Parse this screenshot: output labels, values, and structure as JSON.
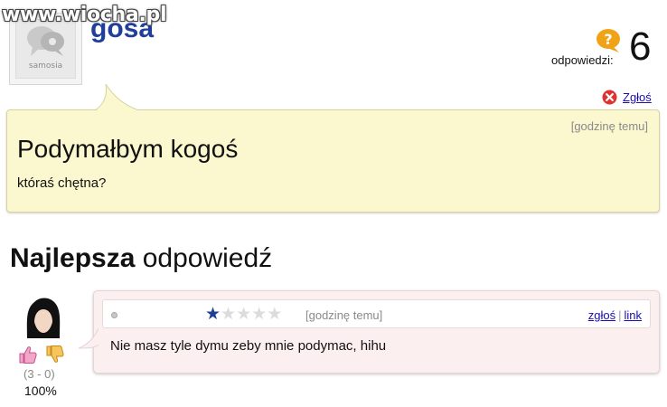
{
  "watermark": {
    "text": "www.wiocha.pl"
  },
  "asker": {
    "avatar_brand": "samosia",
    "username": "gosa"
  },
  "stats": {
    "answers_label": "odpowiedzi:",
    "answers_count": "6",
    "icon": "question-mark-icon"
  },
  "question": {
    "report_label": "Zgłoś",
    "time": "[godzinę temu]",
    "title": "Podymałbym kogoś",
    "body": "któraś chętna?",
    "bg_color": "#fbf7cf"
  },
  "best_answer": {
    "heading_bold": "Najlepsza",
    "heading_rest": " odpowiedź",
    "votes": "(3 - 0)",
    "percent": "100%",
    "rating": 1,
    "rating_max": 5,
    "time": "[godzinę temu]",
    "report_link": "zgłoś",
    "separator": "|",
    "permalink": "link",
    "body": "Nie masz tyle dymu zeby mnie podymac, hihu",
    "bg_color": "#fcefef",
    "icons": [
      "thumbs-up-icon",
      "thumbs-down-icon",
      "star-icon"
    ]
  }
}
